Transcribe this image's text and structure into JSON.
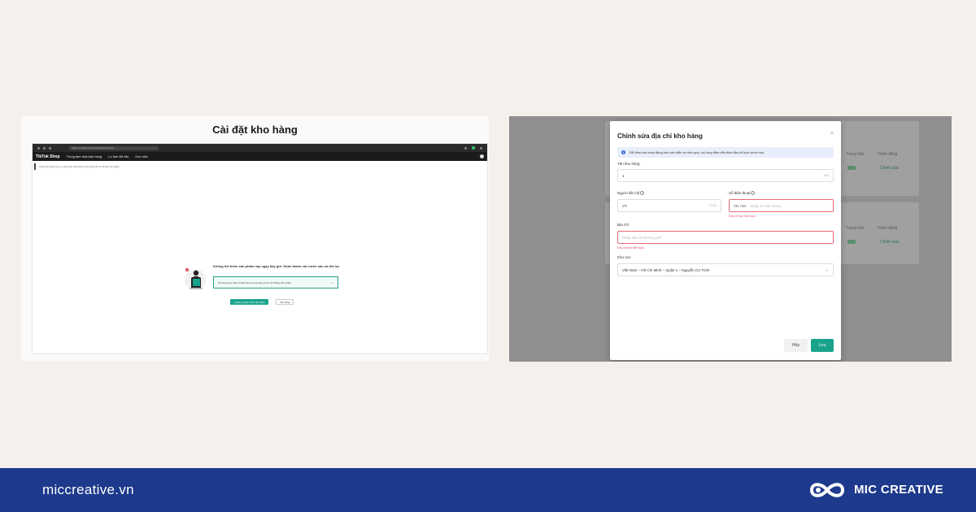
{
  "left_panel": {
    "title": "Cài đặt kho hàng",
    "browser": {
      "url": "seller-vn.tiktok.com/product/warehouse",
      "nav": {
        "logo": "TikTok Shop",
        "center_title": "Trung tâm nhà bán hàng",
        "links": [
          "Lo bán Đề Mọ",
          "Học viện"
        ]
      },
      "notice": "Thông báo quan trọng: vui lòng cập nhật thông tin kho hàng để có thể thêm sản phẩm."
    },
    "empty_state": {
      "title": "Không thể thêm sản phẩm này ngay bây giờ. Hoàn thành các bước sau và thử lại.",
      "alert": "Vui lòng thêm địa chỉ lấy hàng và trả hàng trước khi đăng sản phẩm.",
      "primary_button": "+ Quản lý danh sách sản phẩm",
      "secondary_button": "Tải xuống"
    }
  },
  "right_panel": {
    "background": {
      "columns": [
        "Trạng thái",
        "Hành động"
      ],
      "action_link": "Chỉnh sửa"
    },
    "modal": {
      "title": "Chỉnh sửa địa chỉ kho hàng",
      "info": "Để đảm bảo hoạt động kho vận diễn ra hiệu quả, vui lòng điền cẩn thận địa chỉ kho chính xác.",
      "fields": {
        "warehouse_name": {
          "label": "Tên kho hàng",
          "value": "1",
          "count": "1/50"
        },
        "contact": {
          "label": "Người liên hệ",
          "value": "VT",
          "count": "2/100"
        },
        "phone": {
          "label": "Số điện thoại",
          "prefix": "VN +84",
          "placeholder": "Nhập số điện thoại",
          "error": "Đây là mục bắt buộc"
        },
        "address": {
          "label": "Địa chỉ",
          "placeholder": "Nhập địa chỉ đường phố",
          "error": "Đây là mục bắt buộc"
        },
        "region": {
          "label": "Khu vực",
          "value": "Việt Nam – Hồ Chí Minh – Quận 1 – Nguyễn Cư Trinh"
        }
      },
      "cancel": "Hủy",
      "save": "Lưu"
    }
  },
  "footer": {
    "site": "miccreative.vn",
    "brand": "MIC CREATIVE"
  },
  "colors": {
    "accent": "#1aa38c",
    "footer_bg": "#1d3a8c",
    "error": "#e0505f",
    "info_bg": "#e8eefb"
  }
}
